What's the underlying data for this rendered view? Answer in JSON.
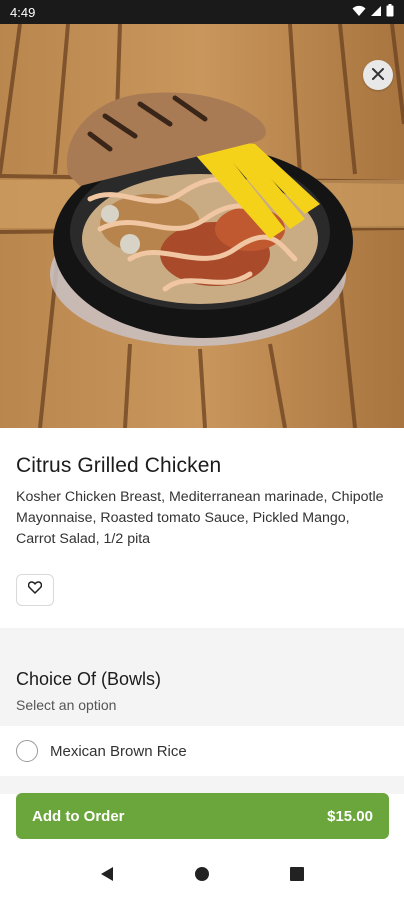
{
  "status_bar": {
    "time": "4:49",
    "icons": [
      "wifi-icon",
      "signal-icon",
      "battery-icon"
    ]
  },
  "hero": {
    "image_alt": "Citrus Grilled Chicken bowl"
  },
  "item": {
    "title": "Citrus Grilled Chicken",
    "description": "Kosher Chicken Breast, Mediterranean marinade, Chipotle Mayonnaise, Roasted tomato Sauce, Pickled Mango, Carrot Salad, 1/2 pita"
  },
  "choice": {
    "title": "Choice Of (Bowls)",
    "subtitle": "Select an option",
    "options": [
      {
        "label": "Mexican Brown Rice",
        "selected": false
      }
    ]
  },
  "order": {
    "label": "Add to Order",
    "price": "$15.00"
  },
  "colors": {
    "accent": "#6aa63b",
    "status_bar": "#1a1a1a"
  }
}
